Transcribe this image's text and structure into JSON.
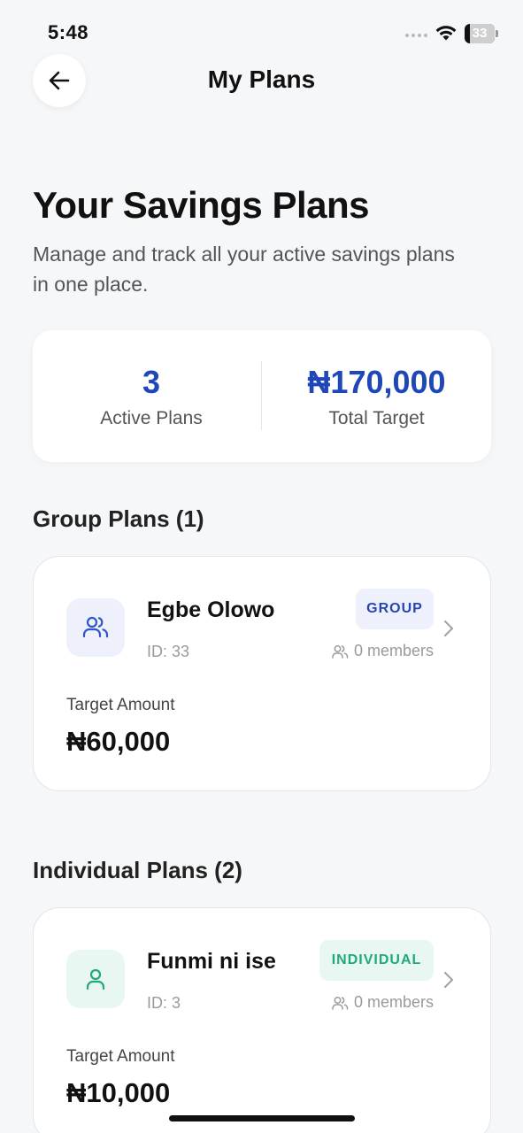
{
  "status_bar": {
    "time": "5:48",
    "battery": "33"
  },
  "header": {
    "title": "My Plans"
  },
  "intro": {
    "title": "Your Savings Plans",
    "subtitle": "Manage and track all your active savings plans in one place."
  },
  "summary": {
    "active_plans_value": "3",
    "active_plans_label": "Active Plans",
    "total_target_value": "₦170,000",
    "total_target_label": "Total Target"
  },
  "colors": {
    "accent_blue": "#1f47b8",
    "group_badge_bg": "#eef1fb",
    "individual_badge_bg": "#e8f7f1",
    "individual_green": "#21a97a"
  },
  "group_section": {
    "title": "Group Plans (1)",
    "plans": [
      {
        "name": "Egbe Olowo",
        "id": "ID: 33",
        "badge": "GROUP",
        "members": "0 members",
        "target_label": "Target Amount",
        "target_value": "₦60,000",
        "icon": "users-icon"
      }
    ]
  },
  "individual_section": {
    "title": "Individual Plans (2)",
    "plans": [
      {
        "name": "Funmi ni ise",
        "id": "ID: 3",
        "badge": "INDIVIDUAL",
        "members": "0 members",
        "target_label": "Target Amount",
        "target_value": "₦10,000",
        "icon": "user-icon"
      }
    ]
  }
}
